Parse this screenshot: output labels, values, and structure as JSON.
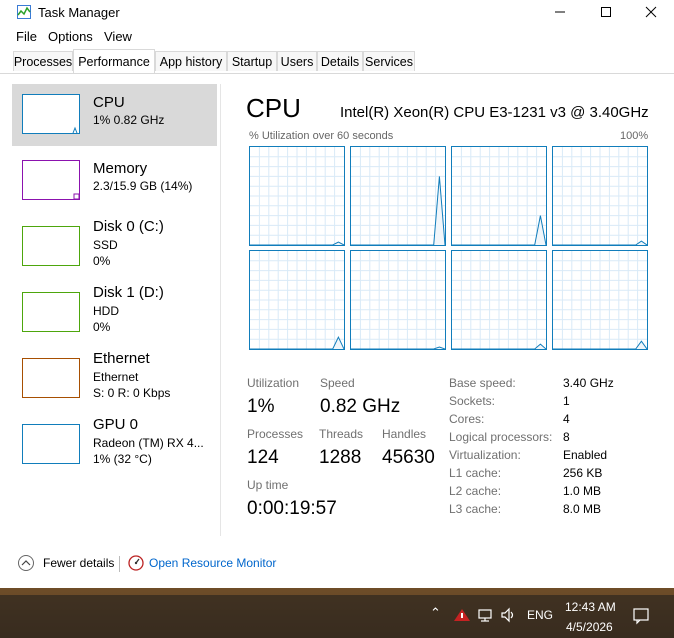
{
  "window": {
    "title": "Task Manager",
    "menu": [
      "File",
      "Options",
      "View"
    ],
    "tabs": [
      "Processes",
      "Performance",
      "App history",
      "Startup",
      "Users",
      "Details",
      "Services"
    ]
  },
  "sidebar": {
    "items": [
      {
        "title": "CPU",
        "line1": "1% 0.82 GHz",
        "line2": ""
      },
      {
        "title": "Memory",
        "line1": "2.3/15.9 GB (14%)",
        "line2": ""
      },
      {
        "title": "Disk 0 (C:)",
        "line1": "SSD",
        "line2": "0%"
      },
      {
        "title": "Disk 1 (D:)",
        "line1": "HDD",
        "line2": "0%"
      },
      {
        "title": "Ethernet",
        "line1": "Ethernet",
        "line2": "S: 0 R: 0 Kbps"
      },
      {
        "title": "GPU 0",
        "line1": "Radeon (TM) RX 4...",
        "line2": "1% (32 °C)"
      }
    ]
  },
  "cpu": {
    "title": "CPU",
    "model": "Intel(R) Xeon(R) CPU E3-1231 v3 @ 3.40GHz",
    "graph_label": "% Utilization over 60 seconds",
    "graph_max": "100%",
    "core_spikes": [
      [
        0,
        0,
        0,
        0,
        0,
        0,
        0,
        0,
        0,
        0,
        3,
        0
      ],
      [
        0,
        0,
        0,
        0,
        0,
        0,
        0,
        0,
        0,
        0,
        70,
        0
      ],
      [
        0,
        0,
        0,
        0,
        0,
        0,
        0,
        0,
        0,
        0,
        30,
        0
      ],
      [
        0,
        0,
        0,
        0,
        0,
        0,
        0,
        0,
        0,
        0,
        4,
        0
      ],
      [
        0,
        0,
        0,
        0,
        0,
        0,
        0,
        0,
        0,
        0,
        12,
        0
      ],
      [
        0,
        0,
        0,
        0,
        0,
        0,
        0,
        0,
        0,
        0,
        2,
        0
      ],
      [
        0,
        0,
        0,
        0,
        0,
        0,
        0,
        0,
        0,
        0,
        5,
        0
      ],
      [
        0,
        0,
        0,
        0,
        0,
        0,
        0,
        0,
        0,
        0,
        8,
        0
      ]
    ],
    "stats": {
      "utilization_label": "Utilization",
      "utilization": "1%",
      "speed_label": "Speed",
      "speed": "0.82 GHz",
      "processes_label": "Processes",
      "processes": "124",
      "threads_label": "Threads",
      "threads": "1288",
      "handles_label": "Handles",
      "handles": "45630",
      "uptime_label": "Up time",
      "uptime": "0:00:19:57"
    },
    "specs": [
      {
        "label": "Base speed:",
        "value": "3.40 GHz"
      },
      {
        "label": "Sockets:",
        "value": "1"
      },
      {
        "label": "Cores:",
        "value": "4"
      },
      {
        "label": "Logical processors:",
        "value": "8"
      },
      {
        "label": "Virtualization:",
        "value": "Enabled"
      },
      {
        "label": "L1 cache:",
        "value": "256 KB"
      },
      {
        "label": "L2 cache:",
        "value": "1.0 MB"
      },
      {
        "label": "L3 cache:",
        "value": "8.0 MB"
      }
    ]
  },
  "footer": {
    "fewer_details": "Fewer details",
    "resource_monitor": "Open Resource Monitor"
  },
  "taskbar": {
    "language": "ENG",
    "time": "12:43 AM",
    "date": "4/5/2026"
  },
  "colors": {
    "cpu": "#117dbb",
    "memory": "#8b12ae",
    "disk": "#4da60c",
    "ethernet": "#a74f01",
    "gpu": "#117dbb",
    "link": "#0066cc"
  }
}
